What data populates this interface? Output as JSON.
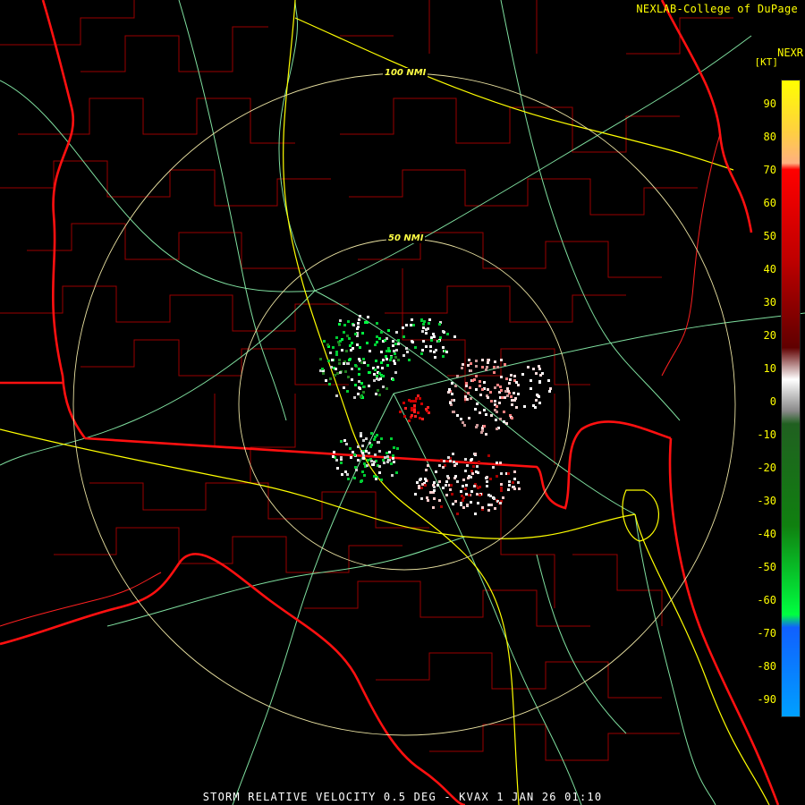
{
  "credit": "NEXLAB-College of DuPage",
  "product_label": "NEXR",
  "units_label": "[KT]",
  "ring_labels": [
    "100 NMI",
    "50 NMI"
  ],
  "scale_ticks": [
    "90",
    "80",
    "70",
    "60",
    "50",
    "40",
    "30",
    "20",
    "10",
    "0",
    "-10",
    "-20",
    "-30",
    "-40",
    "-50",
    "-60",
    "-70",
    "-80",
    "-90"
  ],
  "footer": "STORM RELATIVE VELOCITY 0.5 DEG - KVAX 1 JAN 26 01:10",
  "colors": {
    "background": "#000000",
    "county_lines": "#a00000",
    "state_lines": "#ff1010",
    "highways": "#ffff00",
    "roads": "#7fdf9f",
    "range_rings": "#e8e0a0",
    "text": "#ffff00",
    "footer_text": "#ffffff"
  }
}
